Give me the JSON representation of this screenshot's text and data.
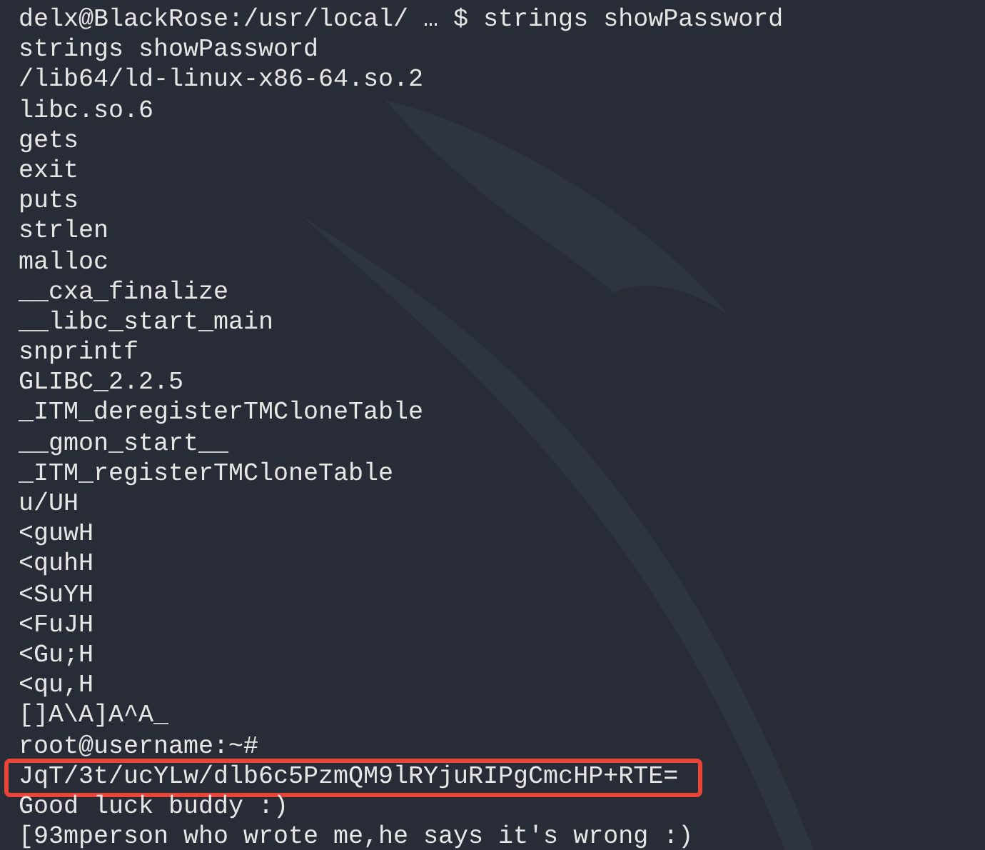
{
  "terminal": {
    "lines": [
      {
        "kind": "prompt",
        "text": "delx@BlackRose:/usr/local/ … $ strings showPassword"
      },
      {
        "kind": "output",
        "text": "strings showPassword"
      },
      {
        "kind": "output",
        "text": "/lib64/ld-linux-x86-64.so.2"
      },
      {
        "kind": "output",
        "text": "libc.so.6"
      },
      {
        "kind": "output",
        "text": "gets"
      },
      {
        "kind": "output",
        "text": "exit"
      },
      {
        "kind": "output",
        "text": "puts"
      },
      {
        "kind": "output",
        "text": "strlen"
      },
      {
        "kind": "output",
        "text": "malloc"
      },
      {
        "kind": "output",
        "text": "__cxa_finalize"
      },
      {
        "kind": "output",
        "text": "__libc_start_main"
      },
      {
        "kind": "output",
        "text": "snprintf"
      },
      {
        "kind": "output",
        "text": "GLIBC_2.2.5"
      },
      {
        "kind": "output",
        "text": "_ITM_deregisterTMCloneTable"
      },
      {
        "kind": "output",
        "text": "__gmon_start__"
      },
      {
        "kind": "output",
        "text": "_ITM_registerTMCloneTable"
      },
      {
        "kind": "output",
        "text": "u/UH"
      },
      {
        "kind": "output",
        "text": "<guwH"
      },
      {
        "kind": "output",
        "text": "<quhH"
      },
      {
        "kind": "output",
        "text": "<SuYH"
      },
      {
        "kind": "output",
        "text": "<FuJH"
      },
      {
        "kind": "output",
        "text": "<Gu;H"
      },
      {
        "kind": "output",
        "text": "<qu,H"
      },
      {
        "kind": "output",
        "text": "[]A\\A]A^A_"
      },
      {
        "kind": "output",
        "text": "root@username:~#"
      },
      {
        "kind": "highlighted",
        "text": "JqT/3t/ucYLw/dlb6c5PzmQM9lRYjuRIPgCmcHP+RTE="
      },
      {
        "kind": "output",
        "text": "Good luck buddy :)"
      },
      {
        "kind": "output",
        "text": "[93mperson who wrote me,he says it's wrong :)"
      }
    ]
  }
}
